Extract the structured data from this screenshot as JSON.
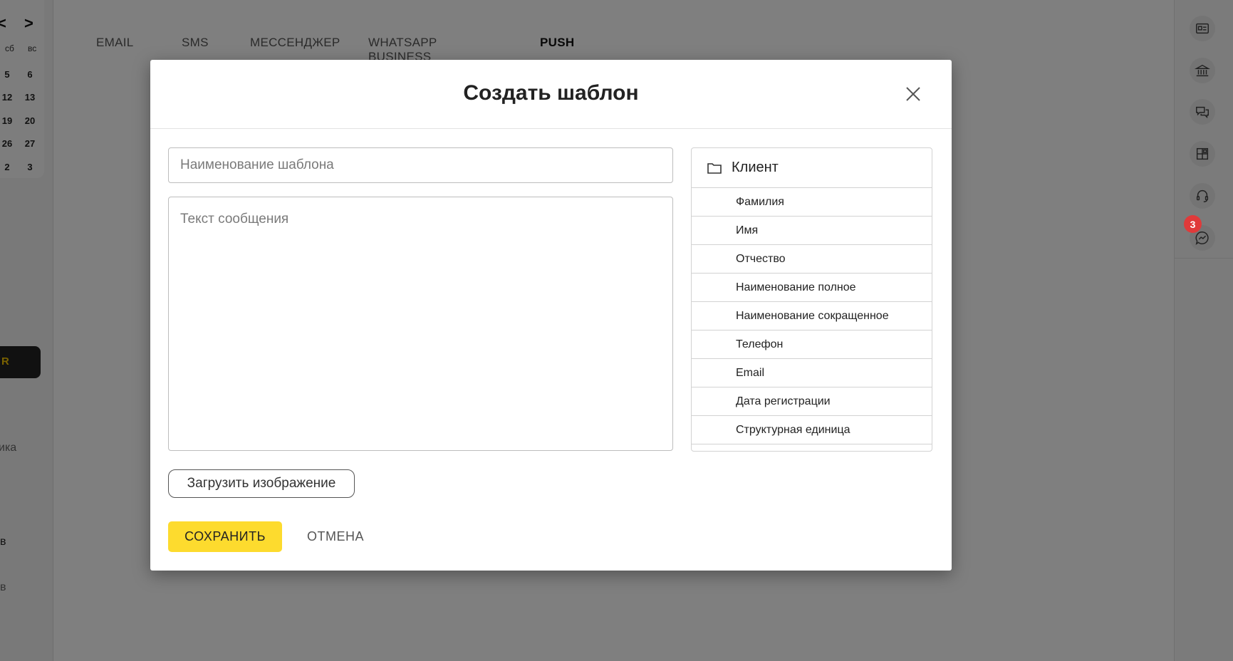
{
  "calendar": {
    "prev": "<",
    "next": ">",
    "weekday_sat": "сб",
    "weekday_sun": "вс",
    "rows": [
      [
        "5",
        "6"
      ],
      [
        "12",
        "13"
      ],
      [
        "19",
        "20"
      ],
      [
        "26",
        "27"
      ],
      [
        "2",
        "3"
      ]
    ]
  },
  "left_sidebar": {
    "dark_button_fragment": "R",
    "frag_1": "ика",
    "frag_2": "в",
    "frag_3": "в"
  },
  "tabs": [
    {
      "label": "EMAIL"
    },
    {
      "label": "SMS"
    },
    {
      "label": "МЕССЕНДЖЕР"
    },
    {
      "label": "WHATSAPP BUSINESS"
    },
    {
      "label": "PUSH"
    }
  ],
  "right_rail": {
    "icons": [
      "contact-card-icon",
      "bank-icon",
      "chat-icon",
      "grid-icon",
      "headset-icon",
      "messenger-icon"
    ],
    "badge_count": "3"
  },
  "modal": {
    "title": "Создать шаблон",
    "name_placeholder": "Наименование шаблона",
    "message_placeholder": "Текст сообщения",
    "fields_group": "Клиент",
    "fields": [
      "Фамилия",
      "Имя",
      "Отчество",
      "Наименование полное",
      "Наименование сокращенное",
      "Телефон",
      "Email",
      "Дата регистрации",
      "Структурная единица"
    ],
    "upload_label": "Загрузить изображение",
    "save_label": "СОХРАНИТЬ",
    "cancel_label": "ОТМЕНА"
  },
  "colors": {
    "accent": "#fddb2e",
    "badge": "#e03a3a",
    "overlay": "rgba(0,0,0,0.5)"
  }
}
